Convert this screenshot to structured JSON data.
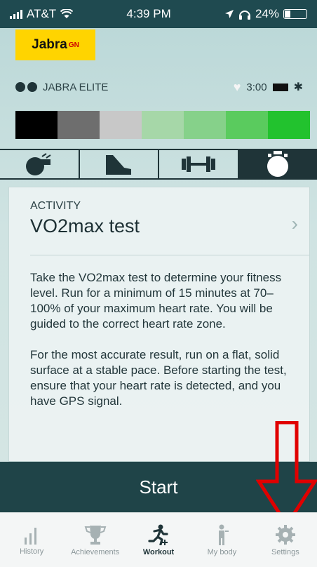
{
  "statusbar": {
    "carrier": "AT&T",
    "time": "4:39 PM",
    "battery": "24%"
  },
  "brand": {
    "logo_text": "Jabra",
    "logo_super": "GN"
  },
  "device": {
    "name": "JABRA ELITE",
    "time_remaining": "3:00"
  },
  "zones": {
    "colors": [
      "#000000",
      "#6e6e6e",
      "#c8c8c8",
      "#a6d7a8",
      "#86d18a",
      "#5acb5e",
      "#22c22e"
    ]
  },
  "tabs": {
    "icons": [
      "whistle-icon",
      "shoe-icon",
      "dumbbell-icon",
      "stopwatch-icon"
    ],
    "selected_index": 3
  },
  "card": {
    "label": "ACTIVITY",
    "title": "VO2max test",
    "paragraph1": "Take the VO2max test to determine your fitness level. Run for a minimum of 15 minutes at 70–100% of your maximum heart rate. You will be guided to the correct heart rate zone.",
    "paragraph2": "For the most accurate result, run on a flat, solid surface at a stable pace. Before starting the test, ensure that your heart rate is detected, and you have GPS signal."
  },
  "start_button": {
    "label": "Start"
  },
  "bottom_nav": {
    "items": [
      {
        "label": "History",
        "icon": "bar-chart-icon"
      },
      {
        "label": "Achievements",
        "icon": "trophy-icon"
      },
      {
        "label": "Workout",
        "icon": "runner-icon"
      },
      {
        "label": "My body",
        "icon": "body-icon"
      },
      {
        "label": "Settings",
        "icon": "gear-icon"
      }
    ],
    "active_index": 2
  },
  "colors": {
    "status_bar": "#1f4a50",
    "accent_dark": "#1f4448",
    "logo_yellow": "#ffd400",
    "annotation_red": "#e00000"
  }
}
